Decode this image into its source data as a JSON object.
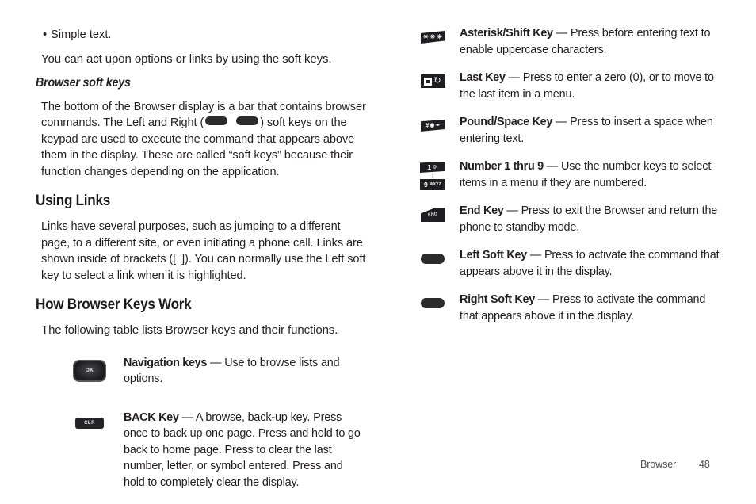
{
  "document": {
    "footer": {
      "chapter": "Browser",
      "page_number": "48"
    }
  },
  "left_column": {
    "bullet": {
      "marker": "•",
      "text": "Simple text."
    },
    "intro_paragraph": "You can act upon options or links by using the soft keys.",
    "subheading": "Browser soft keys",
    "browser_softkeys_paragraph": {
      "part1": "The bottom of the Browser display is a bar that contains browser commands. The Left and Right (",
      "part2": ") soft keys on the keypad are used to execute the command that appears above them in the display. These are called “soft keys” because their function changes depending on the application."
    },
    "heading_using_links": "Using Links",
    "using_links_paragraph": {
      "part1": "Links have several purposes, such as jumping to a different page, to a different site, or even initiating a phone call. Links are shown inside of brackets ([",
      "part2": "]). You can normally use the Left soft key to select a link when it is highlighted."
    },
    "heading_how_browser_keys_work": "How Browser Keys Work",
    "table_intro": "The following table lists Browser keys and their functions.",
    "key_rows": [
      {
        "icon": "navigation-ok-key-icon",
        "icon_label": "OK",
        "name": "Navigation keys",
        "dash": "—",
        "description": "Use to browse lists and options."
      },
      {
        "icon": "clr-back-key-icon",
        "icon_label": "CLR",
        "name": "BACK Key",
        "dash": "—",
        "description": "A browse, back-up key. Press once to back up one page. Press and hold to go back to home page. Press to clear the last number, letter, or symbol entered. Press and hold to completely clear the display."
      }
    ]
  },
  "right_column": {
    "key_rows": [
      {
        "icon": "asterisk-shift-key-icon",
        "icon_glyphs": [
          "✳",
          "✳",
          "✳"
        ],
        "name": "Asterisk/Shift Key",
        "dash": "—",
        "description": "Press before entering text to enable uppercase characters."
      },
      {
        "icon": "last-key-icon",
        "icon_glyphs": [
          "▣",
          "↻"
        ],
        "name": "Last Key",
        "dash": "—",
        "description": "Press to enter a zero (0), or to move to the last item in a menu."
      },
      {
        "icon": "pound-space-key-icon",
        "icon_glyphs": [
          "#",
          "◉",
          "➛"
        ],
        "name": "Pound/Space Key",
        "dash": "—",
        "description": "Press to insert a space when entering text."
      },
      {
        "icon": "number-keys-icon",
        "icon_top_digit": "1",
        "icon_top_sub": "@.",
        "icon_bottom_digit": "9",
        "icon_bottom_sub": "WXYZ",
        "icon_connector": "⁞",
        "name": "Number 1 thru 9",
        "dash": "—",
        "description": "Use the number keys to select items in a menu if they are numbered."
      },
      {
        "icon": "end-key-icon",
        "icon_label": "END",
        "name": "End Key",
        "dash": "—",
        "description": "Press to exit the Browser and return the phone to standby mode."
      },
      {
        "icon": "left-soft-key-icon",
        "name": "Left Soft Key",
        "dash": "—",
        "description": "Press to activate the command that appears above it in the display."
      },
      {
        "icon": "right-soft-key-icon",
        "name": "Right Soft Key",
        "dash": "—",
        "description": "Press to activate the command that appears above it in the display."
      }
    ]
  },
  "colors": {
    "text": "#231f20",
    "key_dark": "#1f1f21",
    "footer_text": "#4d4d4f"
  }
}
